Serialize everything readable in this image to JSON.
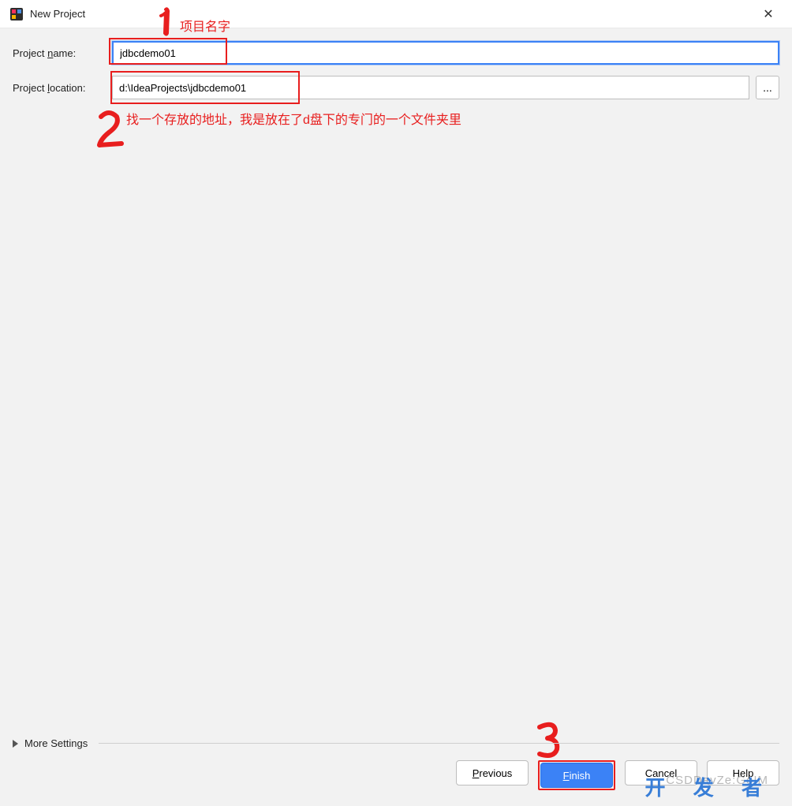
{
  "window": {
    "title": "New Project",
    "close_icon": "✕"
  },
  "form": {
    "name_label_pre": "Project ",
    "name_label_u": "n",
    "name_label_post": "ame:",
    "name_value": "jdbcdemo01",
    "location_label_pre": "Project ",
    "location_label_u": "l",
    "location_label_post": "ocation:",
    "location_value": "d:\\IdeaProjects\\jdbcdemo01",
    "browse_label": "..."
  },
  "annotations": {
    "num1": "1",
    "label1": "项目名字",
    "num2": "2",
    "label2": "找一个存放的地址，我是放在了d盘下的专门的一个文件夹里",
    "num3": "3"
  },
  "more_settings": {
    "label": "More Settings"
  },
  "buttons": {
    "previous_u": "P",
    "previous_rest": "revious",
    "finish_u": "F",
    "finish_rest": "inish",
    "cancel": "Cancel",
    "help": "Help"
  },
  "watermark": {
    "big": "开 发 者",
    "small": "CSDDevZe:GoIM"
  }
}
